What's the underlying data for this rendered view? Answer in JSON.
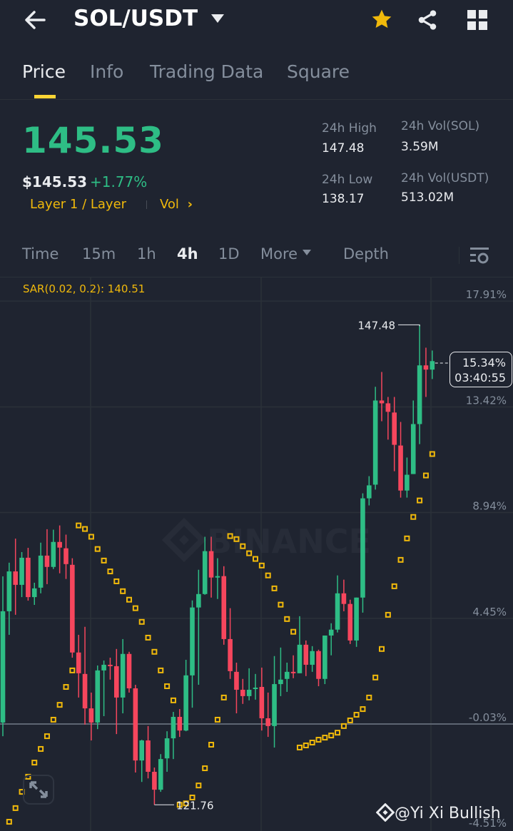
{
  "header": {
    "title": "SOL/USDT",
    "back_icon": "arrow-left-icon",
    "favorite_icon": "star-icon",
    "share_icon": "share-icon",
    "menu_icon": "grid-icon"
  },
  "tabs": [
    {
      "label": "Price",
      "active": true
    },
    {
      "label": "Info"
    },
    {
      "label": "Trading Data"
    },
    {
      "label": "Square"
    }
  ],
  "price": {
    "last": "145.53",
    "usd": "$145.53",
    "change": "+1.77%",
    "tag": "Layer 1 / Layer",
    "vol_link": "Vol",
    "vol_chevron": "›"
  },
  "stats": {
    "high_label": "24h High",
    "high": "147.48",
    "low_label": "24h Low",
    "low": "138.17",
    "vol_sol_label": "24h Vol(SOL)",
    "vol_sol": "3.59M",
    "vol_usdt_label": "24h Vol(USDT)",
    "vol_usdt": "513.02M"
  },
  "timeframes": {
    "items": [
      "Time",
      "15m",
      "1h",
      "4h",
      "1D"
    ],
    "active": "4h",
    "more": "More",
    "depth": "Depth"
  },
  "indicator": "SAR(0.02, 0.2): 140.51",
  "colors": {
    "up": "#2ebd85",
    "down": "#f6465d",
    "sar": "#f0b90b",
    "accent": "#fcd535"
  },
  "chart_data": {
    "type": "candlestick",
    "interval": "4h",
    "y_unit": "%",
    "y_ticks": [
      {
        "value": 17.91,
        "label": "17.91%"
      },
      {
        "value": 13.42,
        "label": "13.42%"
      },
      {
        "value": 8.94,
        "label": "8.94%"
      },
      {
        "value": 4.45,
        "label": "4.45%"
      },
      {
        "value": -0.03,
        "label": "-0.03%"
      },
      {
        "value": -4.51,
        "label": "-4.51%"
      }
    ],
    "max_label": "147.48",
    "min_label": "121.76",
    "current": {
      "label": "15.34%",
      "countdown": "03:40:55",
      "value": 15.06
    },
    "watermark": "BINANCE",
    "candles_ohlc": [
      [
        -0.27,
        5.93,
        -0.85,
        4.45
      ],
      [
        4.45,
        6.51,
        3.45,
        6.14
      ],
      [
        6.14,
        7.53,
        4.3,
        5.57
      ],
      [
        5.57,
        6.96,
        5.05,
        6.72
      ],
      [
        6.72,
        7.14,
        4.9,
        5.05
      ],
      [
        5.05,
        5.66,
        4.72,
        5.42
      ],
      [
        5.45,
        7.36,
        5.21,
        6.81
      ],
      [
        6.81,
        7.93,
        5.6,
        6.33
      ],
      [
        6.33,
        7.91,
        6.24,
        7.39
      ],
      [
        7.39,
        8.09,
        6.06,
        7.15
      ],
      [
        7.12,
        7.7,
        5.82,
        6.45
      ],
      [
        6.42,
        6.7,
        2.48,
        2.7
      ],
      [
        2.7,
        3.45,
        0.79,
        1.82
      ],
      [
        1.79,
        3.79,
        -0.36,
        0.33
      ],
      [
        0.33,
        1.0,
        -1.03,
        -0.27
      ],
      [
        -0.27,
        2.15,
        -0.55,
        1.94
      ],
      [
        1.94,
        2.36,
        0,
        2.18
      ],
      [
        2.18,
        2.48,
        1.55,
        2.15
      ],
      [
        2.12,
        2.85,
        -0.76,
        0.79
      ],
      [
        0.79,
        3.27,
        0.12,
        2.64
      ],
      [
        2.64,
        2.73,
        1.0,
        1.18
      ],
      [
        1.18,
        1.33,
        -2.39,
        -1.88
      ],
      [
        -1.88,
        -1.0,
        -2.79,
        -1.03
      ],
      [
        -1.03,
        -0.42,
        -2.64,
        -2.36
      ],
      [
        -2.36,
        -2.18,
        -3.76,
        -3.12
      ],
      [
        -3.12,
        -1.61,
        -3.21,
        -1.82
      ],
      [
        -1.79,
        -0.64,
        -2.36,
        -0.94
      ],
      [
        -0.94,
        0.18,
        -1.82,
        -0.03
      ],
      [
        -0.03,
        0.3,
        -0.88,
        -0.61
      ],
      [
        -0.61,
        2.39,
        -0.64,
        1.73
      ],
      [
        1.73,
        4.91,
        0.36,
        4.61
      ],
      [
        4.61,
        6.21,
        1.33,
        5.18
      ],
      [
        5.18,
        7.61,
        5.15,
        7.0
      ],
      [
        7.0,
        7.61,
        5.03,
        5.88
      ],
      [
        5.88,
        6.7,
        4.97,
        5.94
      ],
      [
        5.94,
        6.36,
        3.03,
        3.27
      ],
      [
        3.27,
        4.58,
        1.58,
        1.91
      ],
      [
        1.88,
        2.27,
        0.12,
        1.12
      ],
      [
        1.12,
        1.58,
        0.52,
        0.85
      ],
      [
        0.85,
        2.03,
        0.67,
        1.12
      ],
      [
        1.15,
        1.79,
        0.7,
        1.21
      ],
      [
        1.24,
        2.06,
        -0.61,
        -0.09
      ],
      [
        -0.09,
        1.0,
        -0.88,
        -0.42
      ],
      [
        -0.42,
        2.55,
        -1.33,
        1.36
      ],
      [
        1.36,
        2.91,
        0.85,
        1.55
      ],
      [
        1.58,
        2.27,
        1.03,
        1.88
      ],
      [
        1.88,
        2.58,
        1.61,
        1.85
      ],
      [
        1.82,
        4.24,
        1.82,
        3.03
      ],
      [
        3.03,
        3.21,
        1.7,
        2.18
      ],
      [
        2.18,
        2.97,
        1.88,
        2.76
      ],
      [
        2.76,
        2.82,
        1.27,
        1.58
      ],
      [
        1.58,
        3.42,
        1.36,
        3.42
      ],
      [
        3.42,
        3.94,
        2.58,
        3.67
      ],
      [
        3.67,
        5.97,
        3.55,
        5.21
      ],
      [
        5.21,
        5.79,
        4.45,
        4.76
      ],
      [
        4.76,
        4.94,
        3.06,
        3.21
      ],
      [
        3.21,
        5.03,
        2.94,
        5.03
      ],
      [
        5.03,
        9.45,
        4.39,
        9.24
      ],
      [
        9.24,
        10.18,
        8.94,
        9.79
      ],
      [
        9.82,
        13.97,
        9.61,
        13.39
      ],
      [
        13.39,
        14.6,
        12.51,
        13.27
      ],
      [
        13.27,
        13.54,
        11.73,
        12.91
      ],
      [
        12.88,
        13.54,
        10.39,
        11.51
      ],
      [
        11.48,
        12.48,
        9.27,
        9.57
      ],
      [
        9.57,
        10.97,
        9.27,
        10.24
      ],
      [
        10.27,
        13.39,
        10.27,
        12.39
      ],
      [
        12.39,
        16.6,
        11.54,
        14.88
      ],
      [
        14.88,
        15.63,
        13.54,
        14.7
      ],
      [
        14.7,
        15.51,
        14.3,
        15.06
      ]
    ],
    "sar": [
      null,
      -4.48,
      -3.9,
      -3.21,
      -2.57,
      -1.97,
      -1.39,
      -0.85,
      -0.15,
      0.48,
      1.24,
      1.94,
      8.09,
      7.94,
      7.61,
      7.09,
      6.6,
      6.14,
      5.72,
      5.3,
      4.94,
      4.58,
      4.0,
      3.33,
      2.73,
      1.94,
      1.27,
      0.67,
      -3.76,
      -3.7,
      -3.45,
      -2.94,
      -2.21,
      -1.21,
      -0.15,
      0.79,
      7.64,
      7.51,
      7.21,
      6.91,
      6.67,
      6.39,
      5.97,
      5.42,
      4.73,
      4.12,
      3.58,
      -1.33,
      -1.24,
      -1.12,
      -1.0,
      -0.91,
      -0.82,
      -0.7,
      -0.42,
      -0.18,
      0.06,
      0.3,
      0.79,
      1.64,
      2.85,
      4.3,
      5.51,
      6.63,
      7.54,
      8.45,
      9.15,
      10.21,
      11.12
    ]
  },
  "footer": {
    "watermark": "@Yi Xi Bullish",
    "fullscreen_icon": "expand-icon"
  }
}
